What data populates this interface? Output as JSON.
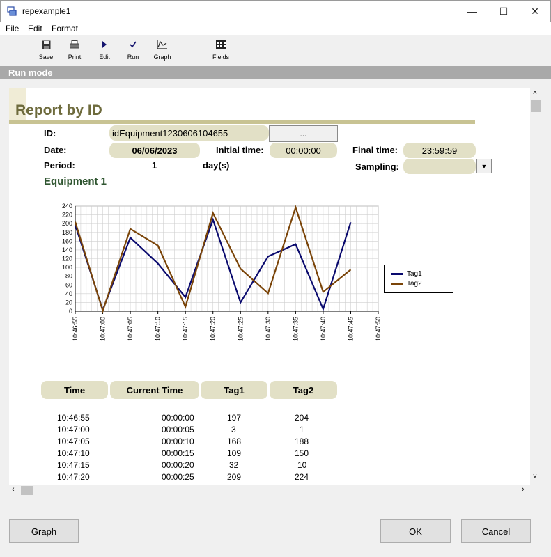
{
  "window": {
    "title": "repexample1",
    "minimize": "—",
    "maximize": "☐",
    "close": "✕"
  },
  "menu": {
    "file": "File",
    "edit": "Edit",
    "format": "Format"
  },
  "toolbar": {
    "save": "Save",
    "print": "Print",
    "edit": "Edit",
    "run": "Run",
    "graph": "Graph",
    "fields": "Fields"
  },
  "mode": "Run mode",
  "report": {
    "title": "Report by ID",
    "id_label": "ID:",
    "id_value": "idEquipment1230606104655",
    "browse_label": "...",
    "date_label": "Date:",
    "date_value": "06/06/2023",
    "initial_time_label": "Initial time:",
    "initial_time_value": "00:00:00",
    "final_time_label": "Final time:",
    "final_time_value": "23:59:59",
    "period_label": "Period:",
    "period_value": "1",
    "period_unit": "day(s)",
    "sampling_label": "Sampling:",
    "sampling_value": "",
    "equipment_title": "Equipment 1"
  },
  "chart_data": {
    "type": "line",
    "x": [
      "10:46:55",
      "10:47:00",
      "10:47:05",
      "10:47:10",
      "10:47:15",
      "10:47:20",
      "10:47:25",
      "10:47:30",
      "10:47:35",
      "10:47:40",
      "10:47:45"
    ],
    "x_ticks": [
      "10:46:55",
      "10:47:00",
      "10:47:05",
      "10:47:10",
      "10:47:15",
      "10:47:20",
      "10:47:25",
      "10:47:30",
      "10:47:35",
      "10:47:40",
      "10:47:45",
      "10:47:50"
    ],
    "y_ticks": [
      0,
      20,
      40,
      60,
      80,
      100,
      120,
      140,
      160,
      180,
      200,
      220,
      240
    ],
    "ylim": [
      0,
      240
    ],
    "grid": true,
    "legend": "right",
    "series": [
      {
        "name": "Tag1",
        "color": "#0a0a6e",
        "values": [
          197,
          3,
          168,
          109,
          32,
          209,
          20,
          125,
          153,
          5,
          203
        ]
      },
      {
        "name": "Tag2",
        "color": "#7a4408",
        "values": [
          204,
          1,
          188,
          150,
          10,
          224,
          97,
          41,
          237,
          44,
          95
        ]
      }
    ]
  },
  "table": {
    "headers": [
      "Time",
      "Current Time",
      "Tag1",
      "Tag2"
    ],
    "rows": [
      [
        "10:46:55",
        "00:00:00",
        "197",
        "204"
      ],
      [
        "10:47:00",
        "00:00:05",
        "3",
        "1"
      ],
      [
        "10:47:05",
        "00:00:10",
        "168",
        "188"
      ],
      [
        "10:47:10",
        "00:00:15",
        "109",
        "150"
      ],
      [
        "10:47:15",
        "00:00:20",
        "32",
        "10"
      ],
      [
        "10:47:20",
        "00:00:25",
        "209",
        "224"
      ]
    ]
  },
  "buttons": {
    "graph": "Graph",
    "ok": "OK",
    "cancel": "Cancel"
  }
}
